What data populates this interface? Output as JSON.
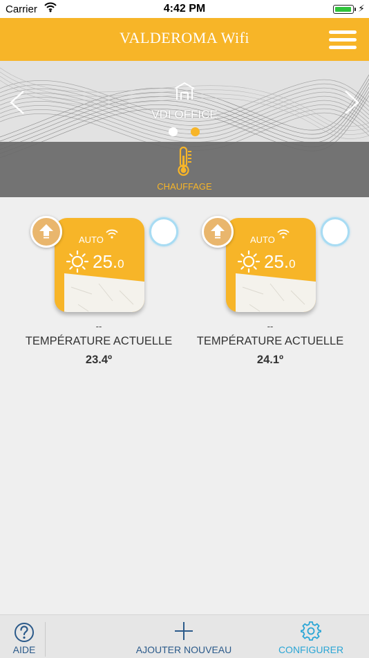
{
  "status_bar": {
    "carrier": "Carrier",
    "time": "4:42 PM",
    "battery_level": 1.0,
    "icons": [
      "wifi-icon",
      "battery-icon",
      "charging-bolt-icon"
    ]
  },
  "header": {
    "title": "VALDEROMA Wifi",
    "menu_icon": "hamburger-menu-icon",
    "color": "#f7b528"
  },
  "banner": {
    "location_name": "VDI OFFICE",
    "location_icon": "home-icon",
    "page_count": 2,
    "active_page": 2,
    "mode_icon": "thermometer-icon",
    "mode_label": "CHAUFFAGE",
    "prev_icon": "chevron-left-icon",
    "next_icon": "chevron-right-icon"
  },
  "devices": [
    {
      "mode": "AUTO",
      "setpoint_int": "25.",
      "setpoint_dec": "0",
      "status": "--",
      "label": "TEMPÉRATURE ACTUELLE",
      "current_temp": "23.4º"
    },
    {
      "mode": "AUTO",
      "setpoint_int": "25.",
      "setpoint_dec": "0",
      "status": "--",
      "label": "TEMPÉRATURE ACTUELLE",
      "current_temp": "24.1º"
    }
  ],
  "tabbar": {
    "help_label": "AIDE",
    "add_label": "AJOUTER NOUVEAU",
    "configure_label": "CONFIGURER",
    "help_icon": "question-circle-icon",
    "add_icon": "plus-icon",
    "configure_icon": "gear-icon"
  },
  "colors": {
    "accent": "#f7b528",
    "tab_text": "#2b5a8a",
    "configure_text": "#2aa6d6",
    "background": "#efefef"
  }
}
